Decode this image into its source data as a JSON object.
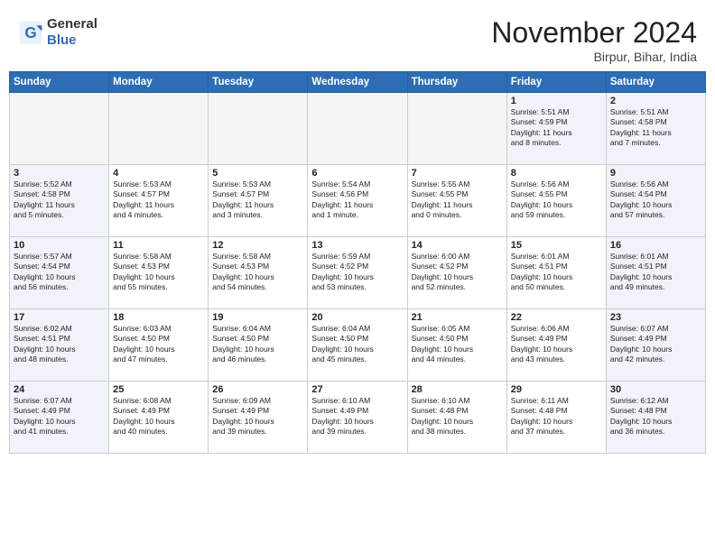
{
  "header": {
    "logo_general": "General",
    "logo_blue": "Blue",
    "month": "November 2024",
    "location": "Birpur, Bihar, India"
  },
  "weekdays": [
    "Sunday",
    "Monday",
    "Tuesday",
    "Wednesday",
    "Thursday",
    "Friday",
    "Saturday"
  ],
  "weeks": [
    [
      {
        "day": "",
        "info": "",
        "type": "empty"
      },
      {
        "day": "",
        "info": "",
        "type": "empty"
      },
      {
        "day": "",
        "info": "",
        "type": "empty"
      },
      {
        "day": "",
        "info": "",
        "type": "empty"
      },
      {
        "day": "",
        "info": "",
        "type": "empty"
      },
      {
        "day": "1",
        "info": "Sunrise: 5:51 AM\nSunset: 4:59 PM\nDaylight: 11 hours\nand 8 minutes.",
        "type": "weekend"
      },
      {
        "day": "2",
        "info": "Sunrise: 5:51 AM\nSunset: 4:58 PM\nDaylight: 11 hours\nand 7 minutes.",
        "type": "weekend"
      }
    ],
    [
      {
        "day": "3",
        "info": "Sunrise: 5:52 AM\nSunset: 4:58 PM\nDaylight: 11 hours\nand 5 minutes.",
        "type": "weekend"
      },
      {
        "day": "4",
        "info": "Sunrise: 5:53 AM\nSunset: 4:57 PM\nDaylight: 11 hours\nand 4 minutes.",
        "type": "normal"
      },
      {
        "day": "5",
        "info": "Sunrise: 5:53 AM\nSunset: 4:57 PM\nDaylight: 11 hours\nand 3 minutes.",
        "type": "normal"
      },
      {
        "day": "6",
        "info": "Sunrise: 5:54 AM\nSunset: 4:56 PM\nDaylight: 11 hours\nand 1 minute.",
        "type": "normal"
      },
      {
        "day": "7",
        "info": "Sunrise: 5:55 AM\nSunset: 4:55 PM\nDaylight: 11 hours\nand 0 minutes.",
        "type": "normal"
      },
      {
        "day": "8",
        "info": "Sunrise: 5:56 AM\nSunset: 4:55 PM\nDaylight: 10 hours\nand 59 minutes.",
        "type": "normal"
      },
      {
        "day": "9",
        "info": "Sunrise: 5:56 AM\nSunset: 4:54 PM\nDaylight: 10 hours\nand 57 minutes.",
        "type": "weekend"
      }
    ],
    [
      {
        "day": "10",
        "info": "Sunrise: 5:57 AM\nSunset: 4:54 PM\nDaylight: 10 hours\nand 56 minutes.",
        "type": "weekend"
      },
      {
        "day": "11",
        "info": "Sunrise: 5:58 AM\nSunset: 4:53 PM\nDaylight: 10 hours\nand 55 minutes.",
        "type": "normal"
      },
      {
        "day": "12",
        "info": "Sunrise: 5:58 AM\nSunset: 4:53 PM\nDaylight: 10 hours\nand 54 minutes.",
        "type": "normal"
      },
      {
        "day": "13",
        "info": "Sunrise: 5:59 AM\nSunset: 4:52 PM\nDaylight: 10 hours\nand 53 minutes.",
        "type": "normal"
      },
      {
        "day": "14",
        "info": "Sunrise: 6:00 AM\nSunset: 4:52 PM\nDaylight: 10 hours\nand 52 minutes.",
        "type": "normal"
      },
      {
        "day": "15",
        "info": "Sunrise: 6:01 AM\nSunset: 4:51 PM\nDaylight: 10 hours\nand 50 minutes.",
        "type": "normal"
      },
      {
        "day": "16",
        "info": "Sunrise: 6:01 AM\nSunset: 4:51 PM\nDaylight: 10 hours\nand 49 minutes.",
        "type": "weekend"
      }
    ],
    [
      {
        "day": "17",
        "info": "Sunrise: 6:02 AM\nSunset: 4:51 PM\nDaylight: 10 hours\nand 48 minutes.",
        "type": "weekend"
      },
      {
        "day": "18",
        "info": "Sunrise: 6:03 AM\nSunset: 4:50 PM\nDaylight: 10 hours\nand 47 minutes.",
        "type": "normal"
      },
      {
        "day": "19",
        "info": "Sunrise: 6:04 AM\nSunset: 4:50 PM\nDaylight: 10 hours\nand 46 minutes.",
        "type": "normal"
      },
      {
        "day": "20",
        "info": "Sunrise: 6:04 AM\nSunset: 4:50 PM\nDaylight: 10 hours\nand 45 minutes.",
        "type": "normal"
      },
      {
        "day": "21",
        "info": "Sunrise: 6:05 AM\nSunset: 4:50 PM\nDaylight: 10 hours\nand 44 minutes.",
        "type": "normal"
      },
      {
        "day": "22",
        "info": "Sunrise: 6:06 AM\nSunset: 4:49 PM\nDaylight: 10 hours\nand 43 minutes.",
        "type": "normal"
      },
      {
        "day": "23",
        "info": "Sunrise: 6:07 AM\nSunset: 4:49 PM\nDaylight: 10 hours\nand 42 minutes.",
        "type": "weekend"
      }
    ],
    [
      {
        "day": "24",
        "info": "Sunrise: 6:07 AM\nSunset: 4:49 PM\nDaylight: 10 hours\nand 41 minutes.",
        "type": "weekend"
      },
      {
        "day": "25",
        "info": "Sunrise: 6:08 AM\nSunset: 4:49 PM\nDaylight: 10 hours\nand 40 minutes.",
        "type": "normal"
      },
      {
        "day": "26",
        "info": "Sunrise: 6:09 AM\nSunset: 4:49 PM\nDaylight: 10 hours\nand 39 minutes.",
        "type": "normal"
      },
      {
        "day": "27",
        "info": "Sunrise: 6:10 AM\nSunset: 4:49 PM\nDaylight: 10 hours\nand 39 minutes.",
        "type": "normal"
      },
      {
        "day": "28",
        "info": "Sunrise: 6:10 AM\nSunset: 4:48 PM\nDaylight: 10 hours\nand 38 minutes.",
        "type": "normal"
      },
      {
        "day": "29",
        "info": "Sunrise: 6:11 AM\nSunset: 4:48 PM\nDaylight: 10 hours\nand 37 minutes.",
        "type": "normal"
      },
      {
        "day": "30",
        "info": "Sunrise: 6:12 AM\nSunset: 4:48 PM\nDaylight: 10 hours\nand 36 minutes.",
        "type": "weekend"
      }
    ]
  ]
}
